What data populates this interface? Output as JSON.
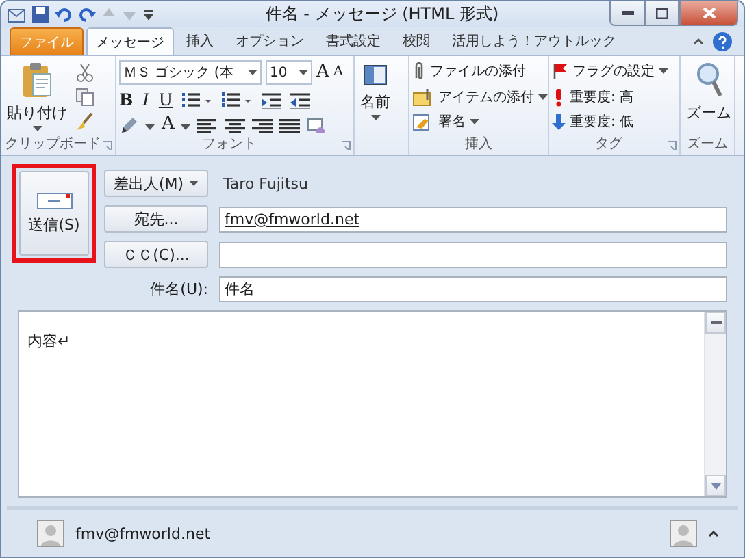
{
  "window": {
    "title": "件名 - メッセージ (HTML 形式)"
  },
  "tabs": [
    {
      "label": "ファイル",
      "kind": "file",
      "selected": false
    },
    {
      "label": "メッセージ",
      "kind": "tab",
      "selected": true
    },
    {
      "label": "挿入",
      "kind": "tab",
      "selected": false
    },
    {
      "label": "オプション",
      "kind": "tab",
      "selected": false
    },
    {
      "label": "書式設定",
      "kind": "tab",
      "selected": false
    },
    {
      "label": "校閲",
      "kind": "tab",
      "selected": false
    },
    {
      "label": "活用しよう！アウトルック",
      "kind": "tab",
      "selected": false
    }
  ],
  "ribbon": [
    {
      "kind": "clipboard",
      "label": "クリップボード",
      "launcher": true,
      "paste": "貼り付け"
    },
    {
      "kind": "font",
      "label": "フォント",
      "launcher": true,
      "font_name": "ＭＳ ゴシック (本",
      "font_size": "10",
      "grow": "A",
      "shrink": "A",
      "bold": "B",
      "italic": "I",
      "underline": "U",
      "font_color": "A"
    },
    {
      "kind": "names",
      "button": "名前"
    },
    {
      "kind": "list",
      "label": "挿入",
      "launcher": false,
      "items": [
        {
          "label": "ファイルの添付",
          "kind": "paperclip",
          "dropdown": false
        },
        {
          "label": "アイテムの添付",
          "kind": "item",
          "dropdown": true
        },
        {
          "label": "署名",
          "kind": "signature",
          "dropdown": true
        }
      ]
    },
    {
      "kind": "list",
      "label": "タグ",
      "launcher": true,
      "items": [
        {
          "label": "フラグの設定",
          "kind": "flag",
          "dropdown": true
        },
        {
          "label": "重要度: 高",
          "kind": "high",
          "dropdown": false
        },
        {
          "label": "重要度: 低",
          "kind": "low",
          "dropdown": false
        }
      ]
    },
    {
      "kind": "zoom",
      "label": "ズーム",
      "button": "ズーム"
    }
  ],
  "compose": {
    "send": "送信(S)",
    "rows": [
      {
        "kind": "from",
        "button": "差出人(M)",
        "value": "Taro Fujitsu"
      },
      {
        "kind": "to",
        "button": "宛先...",
        "value": "fmv@fmworld.net",
        "resolved": true
      },
      {
        "kind": "cc",
        "button": "ＣＣ(C)..."
      },
      {
        "kind": "subject",
        "label": "件名(U):",
        "value": "件名"
      }
    ],
    "body": "内容↵"
  },
  "people_pane": {
    "contact": "fmv@fmworld.net"
  }
}
